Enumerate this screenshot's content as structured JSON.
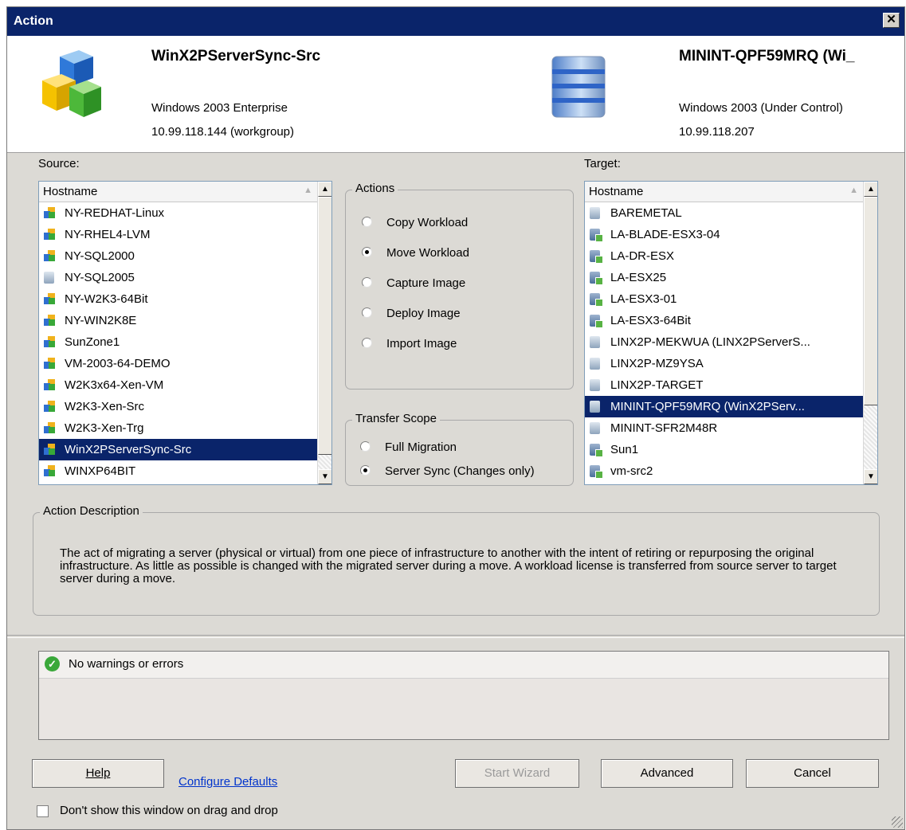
{
  "window": {
    "title": "Action",
    "close_glyph": "✕"
  },
  "source_server": {
    "name": "WinX2PServerSync-Src",
    "os": "Windows 2003 Enterprise",
    "address": "10.99.118.144 (workgroup)",
    "icon": "multi-color-cubes-icon"
  },
  "target_server": {
    "name": "MININT-QPF59MRQ (Wi_",
    "os": "Windows 2003 (Under Control)",
    "address": "10.99.118.207",
    "icon": "server-stack-icon"
  },
  "source_list": {
    "label": "Source:",
    "column": "Hostname",
    "selected": "WinX2PServerSync-Src",
    "items": [
      {
        "name": "NY-REDHAT-Linux",
        "icon": "workload-icon"
      },
      {
        "name": "NY-RHEL4-LVM",
        "icon": "workload-icon"
      },
      {
        "name": "NY-SQL2000",
        "icon": "workload-icon"
      },
      {
        "name": "NY-SQL2005",
        "icon": "server-icon"
      },
      {
        "name": "NY-W2K3-64Bit",
        "icon": "workload-icon"
      },
      {
        "name": "NY-WIN2K8E",
        "icon": "workload-icon"
      },
      {
        "name": "SunZone1",
        "icon": "workload-icon"
      },
      {
        "name": "VM-2003-64-DEMO",
        "icon": "workload-icon"
      },
      {
        "name": "W2K3x64-Xen-VM",
        "icon": "workload-icon"
      },
      {
        "name": "W2K3-Xen-Src",
        "icon": "workload-icon"
      },
      {
        "name": "W2K3-Xen-Trg",
        "icon": "workload-icon"
      },
      {
        "name": "WinX2PServerSync-Src",
        "icon": "workload-icon"
      },
      {
        "name": "WINXP64BIT",
        "icon": "workload-icon"
      }
    ]
  },
  "actions": {
    "label": "Actions",
    "selected": "Move Workload",
    "options": [
      "Copy Workload",
      "Move Workload",
      "Capture Image",
      "Deploy Image",
      "Import Image"
    ]
  },
  "transfer_scope": {
    "label": "Transfer Scope",
    "selected": "Server Sync (Changes only)",
    "options": [
      "Full Migration",
      "Server Sync (Changes only)"
    ]
  },
  "target_list": {
    "label": "Target:",
    "column": "Hostname",
    "selected": "MININT-QPF59MRQ  (WinX2PServ...",
    "items": [
      {
        "name": "BAREMETAL",
        "icon": "container-icon"
      },
      {
        "name": "LA-BLADE-ESX3-04",
        "icon": "host-icon"
      },
      {
        "name": "LA-DR-ESX",
        "icon": "host-icon"
      },
      {
        "name": "LA-ESX25",
        "icon": "host-icon"
      },
      {
        "name": "LA-ESX3-01",
        "icon": "host-icon"
      },
      {
        "name": "LA-ESX3-64Bit",
        "icon": "host-icon"
      },
      {
        "name": "LINX2P-MEKWUA  (LINX2PServerS...",
        "icon": "container-icon"
      },
      {
        "name": "LINX2P-MZ9YSA",
        "icon": "container-icon"
      },
      {
        "name": "LINX2P-TARGET",
        "icon": "container-icon"
      },
      {
        "name": "MININT-QPF59MRQ  (WinX2PServ...",
        "icon": "container-icon"
      },
      {
        "name": "MININT-SFR2M48R",
        "icon": "container-icon"
      },
      {
        "name": "Sun1",
        "icon": "host-icon"
      },
      {
        "name": "vm-src2",
        "icon": "host-icon"
      }
    ]
  },
  "action_description": {
    "label": "Action Description",
    "text": "The act of migrating a server (physical or virtual) from one piece of infrastructure to another with the intent of retiring or repurposing the original infrastructure.  As little as possible is changed with the migrated server during a move.  A workload license is transferred from source server to target server during a move."
  },
  "messages": {
    "text": "No warnings or errors",
    "icon": "check-icon",
    "check_glyph": "✓"
  },
  "buttons": {
    "help": "Help",
    "configure_defaults": "Configure Defaults",
    "start_wizard": "Start Wizard",
    "advanced": "Advanced",
    "cancel": "Cancel"
  },
  "dont_show": {
    "label": "Don't show this window on drag and drop",
    "checked": false
  }
}
